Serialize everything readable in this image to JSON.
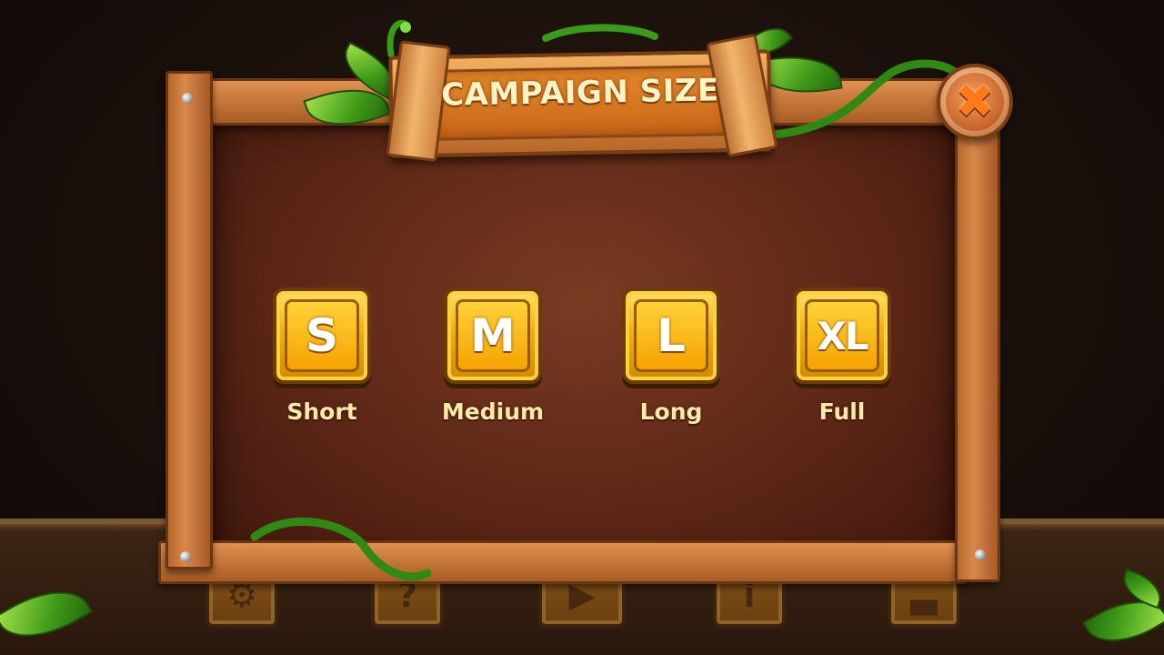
{
  "title": "CAMPAIGN SIZE",
  "close_button": {
    "icon": "close-x-icon",
    "glyph": "✖"
  },
  "size_options": [
    {
      "badge": "S",
      "label": "Short"
    },
    {
      "badge": "M",
      "label": "Medium"
    },
    {
      "badge": "L",
      "label": "Long"
    },
    {
      "badge": "XL",
      "label": "Full"
    }
  ],
  "bottom_menu": [
    {
      "icon": "gear-icon",
      "glyph": "⚙"
    },
    {
      "icon": "help-icon",
      "glyph": "?"
    },
    {
      "icon": "play-icon",
      "glyph": "▶"
    },
    {
      "icon": "info-icon",
      "glyph": "i"
    },
    {
      "icon": "leaderboard-icon",
      "glyph": "▃"
    }
  ],
  "colors": {
    "board_wood": "#d9884a",
    "board_inner": "#5a2516",
    "button_gold": "#f0b010",
    "title_text": "#fff3c2",
    "leaf_green": "#3f9a18"
  }
}
